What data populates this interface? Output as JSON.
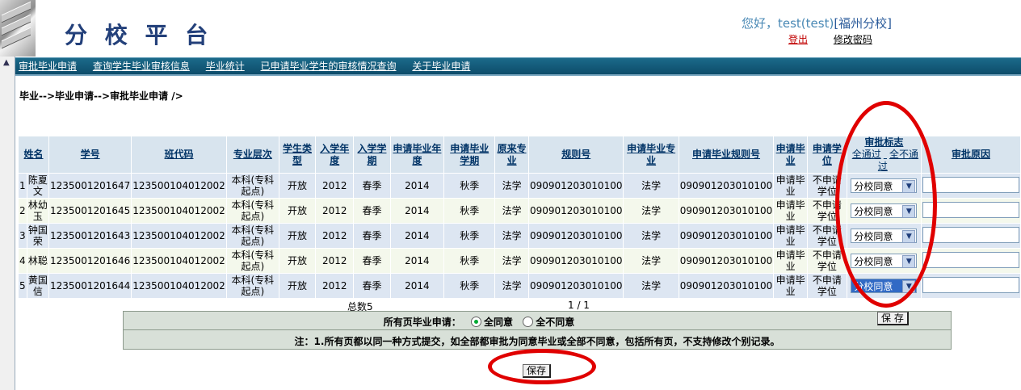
{
  "header": {
    "logo": "分 校 平 台",
    "greeting": "您好，test(test)",
    "campus": "[福州分校]",
    "logout": "登出",
    "change_password": "修改密码"
  },
  "nav": {
    "items": [
      "审批毕业申请",
      "查询学生毕业审核信息",
      "毕业统计",
      "已申请毕业学生的审核情况查询",
      "关于毕业申请"
    ]
  },
  "breadcrumb": "毕业-->毕业申请-->审批毕业申请 />",
  "table": {
    "headers": [
      "姓名",
      "学号",
      "班代码",
      "专业层次",
      "学生类型",
      "入学年度",
      "入学学期",
      "申请毕业年度",
      "申请毕业学期",
      "原来专业",
      "规则号",
      "申请毕业专业",
      "申请毕业规则号",
      "申请毕业",
      "申请学位",
      "审批标志",
      "审批原因"
    ],
    "flag_links": [
      "全通过",
      "全不通过"
    ],
    "rows": [
      {
        "idx": "1",
        "name": "陈夏文",
        "sid": "1235001201647",
        "class": "123500104012002",
        "level": "本科(专科起点)",
        "type": "开放",
        "year": "2012",
        "term": "春季",
        "gyear": "2014",
        "gterm": "秋季",
        "major": "法学",
        "rule": "090901203010100",
        "gmajor": "法学",
        "grule": "090901203010100",
        "apply": "申请毕业",
        "degree": "不申请学位",
        "flag": "分校同意"
      },
      {
        "idx": "2",
        "name": "林幼玉",
        "sid": "1235001201645",
        "class": "123500104012002",
        "level": "本科(专科起点)",
        "type": "开放",
        "year": "2012",
        "term": "春季",
        "gyear": "2014",
        "gterm": "秋季",
        "major": "法学",
        "rule": "090901203010100",
        "gmajor": "法学",
        "grule": "090901203010100",
        "apply": "申请毕业",
        "degree": "不申请学位",
        "flag": "分校同意"
      },
      {
        "idx": "3",
        "name": "钟国荣",
        "sid": "1235001201643",
        "class": "123500104012002",
        "level": "本科(专科起点)",
        "type": "开放",
        "year": "2012",
        "term": "春季",
        "gyear": "2014",
        "gterm": "秋季",
        "major": "法学",
        "rule": "090901203010100",
        "gmajor": "法学",
        "grule": "090901203010100",
        "apply": "申请毕业",
        "degree": "不申请学位",
        "flag": "分校同意"
      },
      {
        "idx": "4",
        "name": "林聪",
        "sid": "1235001201646",
        "class": "123500104012002",
        "level": "本科(专科起点)",
        "type": "开放",
        "year": "2012",
        "term": "春季",
        "gyear": "2014",
        "gterm": "秋季",
        "major": "法学",
        "rule": "090901203010100",
        "gmajor": "法学",
        "grule": "090901203010100",
        "apply": "申请毕业",
        "degree": "不申请学位",
        "flag": "分校同意"
      },
      {
        "idx": "5",
        "name": "黄国信",
        "sid": "1235001201644",
        "class": "123500104012002",
        "level": "本科(专科起点)",
        "type": "开放",
        "year": "2012",
        "term": "春季",
        "gyear": "2014",
        "gterm": "秋季",
        "major": "法学",
        "rule": "090901203010100",
        "gmajor": "法学",
        "grule": "090901203010100",
        "apply": "申请毕业",
        "degree": "不申请学位",
        "flag": "分校同意"
      }
    ]
  },
  "footer": {
    "total": "总数5",
    "pager": "1 / 1"
  },
  "panel": {
    "all_pages_label": "所有页毕业申请：",
    "opt_all_agree": "全同意",
    "opt_all_disagree": "全不同意",
    "selected": "全同意",
    "note": "注：1.所有页都以同一种方式提交，如全部都审批为同意毕业或全部不同意，包括所有页，不支持修改个别记录。"
  },
  "buttons": {
    "save": "保 存",
    "save_bottom": "保存"
  },
  "colors": {
    "nav_bg": "#0d4c6a",
    "header_bg": "#d8e4ee",
    "highlight_ellipse": "#e00000"
  }
}
